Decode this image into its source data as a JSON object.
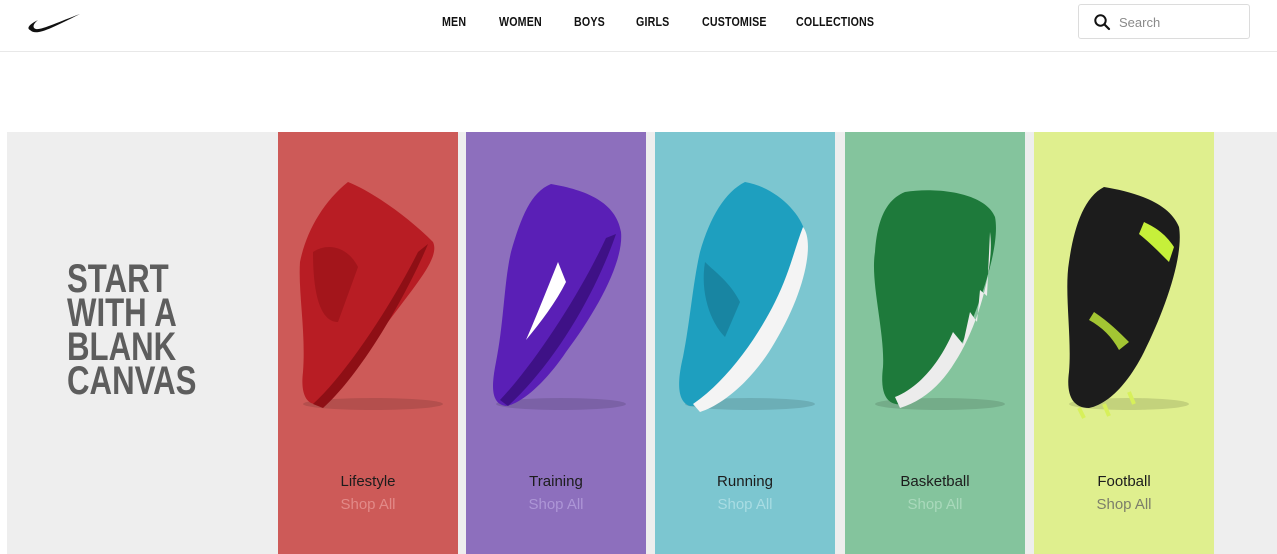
{
  "header": {
    "nav": [
      {
        "label": "MEN"
      },
      {
        "label": "WOMEN"
      },
      {
        "label": "BOYS"
      },
      {
        "label": "GIRLS"
      },
      {
        "label": "CUSTOMISE"
      },
      {
        "label": "COLLECTIONS"
      }
    ],
    "search": {
      "placeholder": "Search",
      "icon": "search-icon"
    },
    "logo": "swoosh-logo"
  },
  "hero": {
    "title_lines": [
      "START",
      "WITH A",
      "BLANK",
      "CANVAS"
    ],
    "background": "#eeeeee",
    "cards": [
      {
        "label": "Lifestyle",
        "link": "Shop All",
        "bg": "#cd5a58",
        "shoe": "#b81d24",
        "link_color": "#e28a88"
      },
      {
        "label": "Training",
        "link": "Shop All",
        "bg": "#8d6fbd",
        "shoe": "#5a1fb6",
        "link_color": "#ad96d6"
      },
      {
        "label": "Running",
        "link": "Shop All",
        "bg": "#7cc6d0",
        "shoe": "#1e9fbf",
        "link_color": "#a8dce3"
      },
      {
        "label": "Basketball",
        "link": "Shop All",
        "bg": "#84c49d",
        "shoe": "#1e7a3b",
        "link_color": "#a9d9bb"
      },
      {
        "label": "Football",
        "link": "Shop All",
        "bg": "#dfef8e",
        "shoe": "#1c1c1c",
        "link_color": "#7c7e6a"
      }
    ]
  }
}
